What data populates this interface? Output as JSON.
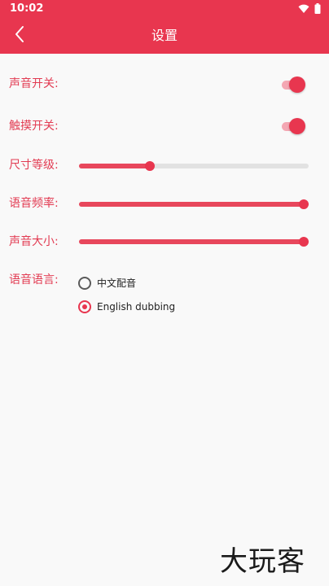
{
  "status_bar": {
    "time": "10:02",
    "icons": [
      "wifi-icon",
      "battery-icon"
    ]
  },
  "app_bar": {
    "title": "设置",
    "back_icon": "chevron-left-icon"
  },
  "settings": {
    "sound_switch": {
      "label": "声音开关:",
      "on": true
    },
    "touch_switch": {
      "label": "触摸开关:",
      "on": true
    },
    "size_level": {
      "label": "尺寸等级:",
      "level": 0.31
    },
    "voice_rate": {
      "label": "语音频率:",
      "level": 1.0
    },
    "volume": {
      "label": "声音大小:",
      "level": 1.0
    },
    "voice_language": {
      "label": "语音语言:",
      "options": [
        {
          "label": "中文配音",
          "selected": false
        },
        {
          "label": "English dubbing",
          "selected": true
        }
      ]
    }
  },
  "watermark": "大玩客",
  "colors": {
    "accent": "#e8364f",
    "label_text": "#e23b52",
    "switch_track": "#f4a7b3",
    "rail": "#e2e2e2",
    "background": "#f9f9f9"
  }
}
